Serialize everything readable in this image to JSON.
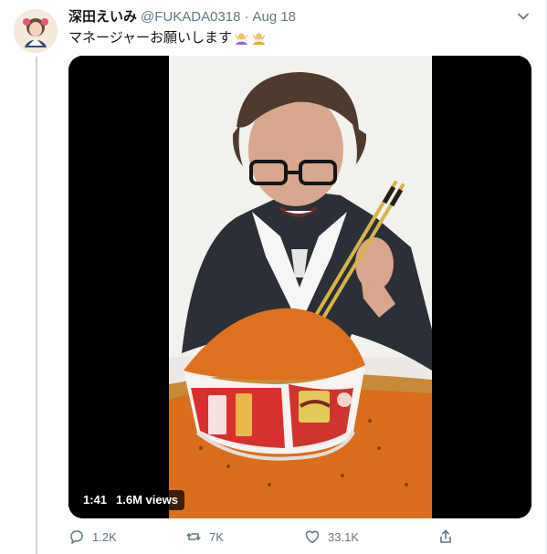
{
  "tweet": {
    "author_name": "深田えいみ",
    "handle": "@FUKADA0318",
    "separator": "·",
    "date": "Aug 18",
    "text": "マネージャーお願いします",
    "emoji": [
      "person-gesturing-icon",
      "person-gesturing-icon"
    ]
  },
  "media": {
    "duration": "1:41",
    "views": "1.6M views"
  },
  "actions": {
    "replies": "1.2K",
    "retweets": "7K",
    "likes": "33.1K"
  },
  "colors": {
    "text": "#14171a",
    "secondary": "#657786",
    "border": "#ccd6dd",
    "background": "#ffffff",
    "media_bg": "#000000",
    "noodle_topping": "#d96e1f"
  },
  "icons": {
    "caret": "chevron-down-icon",
    "reply": "reply-icon",
    "retweet": "retweet-icon",
    "like": "heart-icon",
    "share": "share-icon"
  }
}
